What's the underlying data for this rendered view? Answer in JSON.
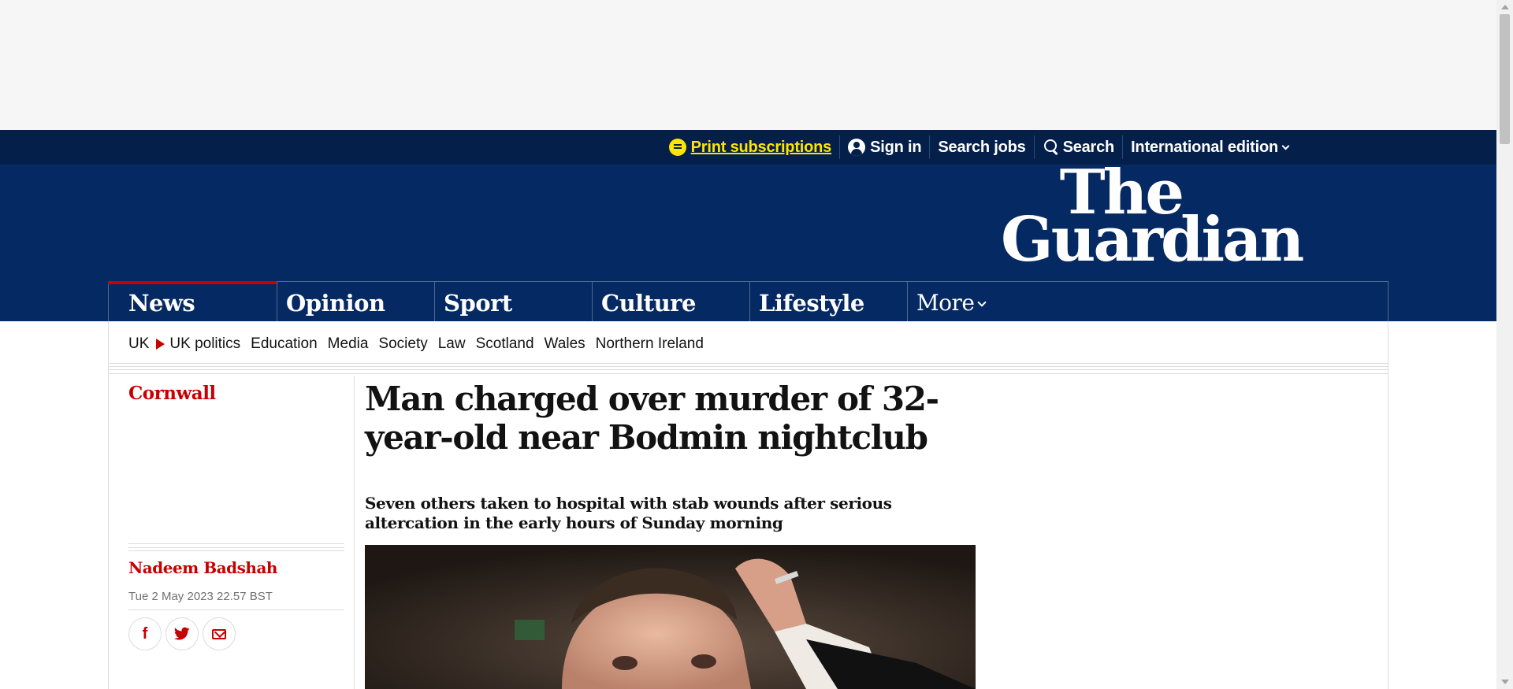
{
  "topbar": {
    "print_subscriptions": "Print subscriptions",
    "sign_in": "Sign in",
    "search_jobs": "Search jobs",
    "search": "Search",
    "edition": "International edition"
  },
  "masthead": {
    "logo_line1": "The",
    "logo_line2": "Guardian",
    "brand_color": "#052962",
    "accent_color": "#c70000"
  },
  "pillars": [
    {
      "label": "News",
      "active": true
    },
    {
      "label": "Opinion"
    },
    {
      "label": "Sport"
    },
    {
      "label": "Culture"
    },
    {
      "label": "Lifestyle"
    }
  ],
  "more_label": "More",
  "subnav": {
    "parent": "UK",
    "items": [
      "UK politics",
      "Education",
      "Media",
      "Society",
      "Law",
      "Scotland",
      "Wales",
      "Northern Ireland"
    ]
  },
  "article": {
    "section": "Cornwall",
    "headline": "Man charged over murder of 32-year-old near Bodmin nightclub",
    "standfirst": "Seven others taken to hospital with stab wounds after serious altercation in the early hours of Sunday morning",
    "byline": "Nadeem Badshah",
    "date": "Tue 2 May 2023 22.57 BST"
  },
  "share": {
    "facebook_glyph": "f",
    "twitter_glyph": "🐦"
  },
  "icons": [
    "print-icon",
    "user-icon",
    "search-icon",
    "chevron-down-icon",
    "facebook-icon",
    "twitter-icon",
    "email-icon"
  ]
}
